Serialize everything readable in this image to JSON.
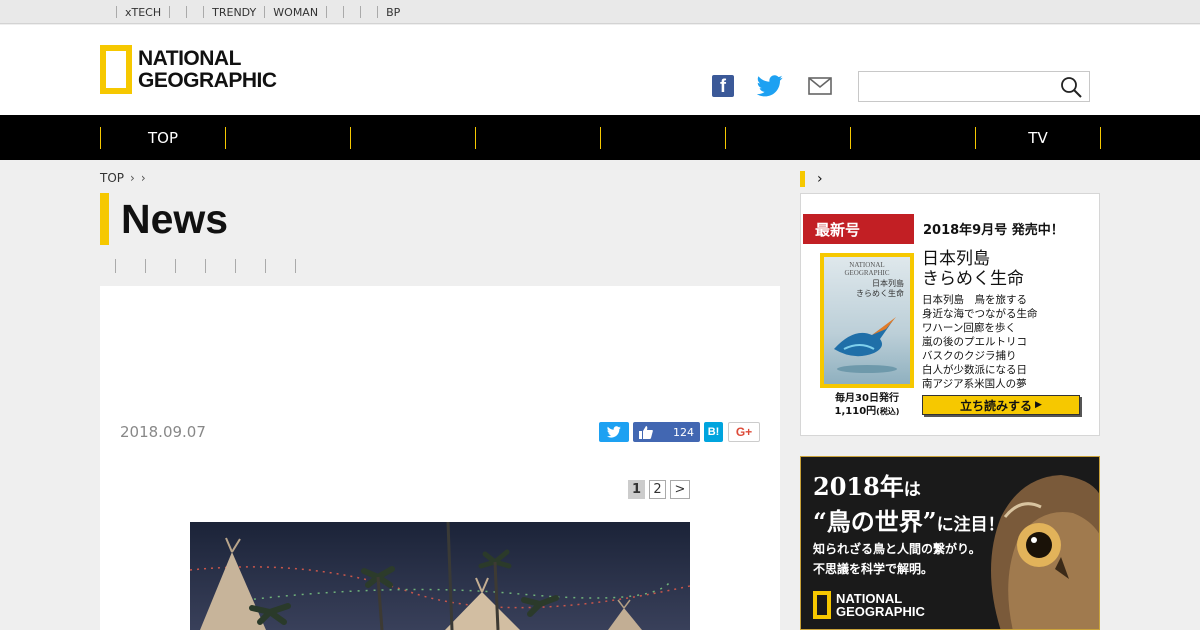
{
  "utility_bar": {
    "links": [
      "xTECH",
      "TRENDY",
      "WOMAN",
      "BP"
    ]
  },
  "header": {
    "logo_line1": "NATIONAL",
    "logo_line2": "GEOGRAPHIC",
    "search_placeholder": ""
  },
  "nav": {
    "items": [
      "TOP",
      "",
      "",
      "",
      "",
      "",
      "",
      "TV"
    ]
  },
  "breadcrumb": {
    "top": "TOP"
  },
  "page": {
    "title": "News"
  },
  "article": {
    "date": "2018.09.07",
    "like_count": "124",
    "hatena": "B!",
    "gplus": "G+",
    "pages": [
      "1",
      "2",
      ">"
    ]
  },
  "magazine": {
    "badge": "最新号",
    "release": "2018年9月号 発売中！",
    "headline_line1": "日本列島",
    "headline_line2": "きらめく生命",
    "contents": [
      "日本列島　鳥を旅する",
      "身近な海でつながる生命",
      "ワハーン回廊を歩く",
      "嵐の後のプエルトリコ",
      "バスクのクジラ捕り",
      "白人が少数派になる日",
      "南アジア系米国人の夢"
    ],
    "issue_line1": "毎月30日発行",
    "issue_line2": "1,110円",
    "issue_tax": "(税込)",
    "cta": "立ち読みする",
    "cover_brand_line1": "NATIONAL",
    "cover_brand_line2": "GEOGRAPHIC",
    "cover_title_line1": "日本列島",
    "cover_title_line2": "きらめく生命"
  },
  "ad": {
    "year": "2018年",
    "year_suffix": "は",
    "headline2": "“鳥の世界”",
    "headline2_suffix": "に注目！",
    "sub_line1": "知られざる鳥と人間の繋がり。",
    "sub_line2": "不思議を科学で解明。",
    "logo_line1": "NATIONAL",
    "logo_line2": "GEOGRAPHIC"
  },
  "colors": {
    "brand_yellow": "#f6c800",
    "nav_bg": "#000000",
    "badge_red": "#c21f24",
    "twitter": "#1da1f2",
    "facebook": "#3b5998"
  }
}
